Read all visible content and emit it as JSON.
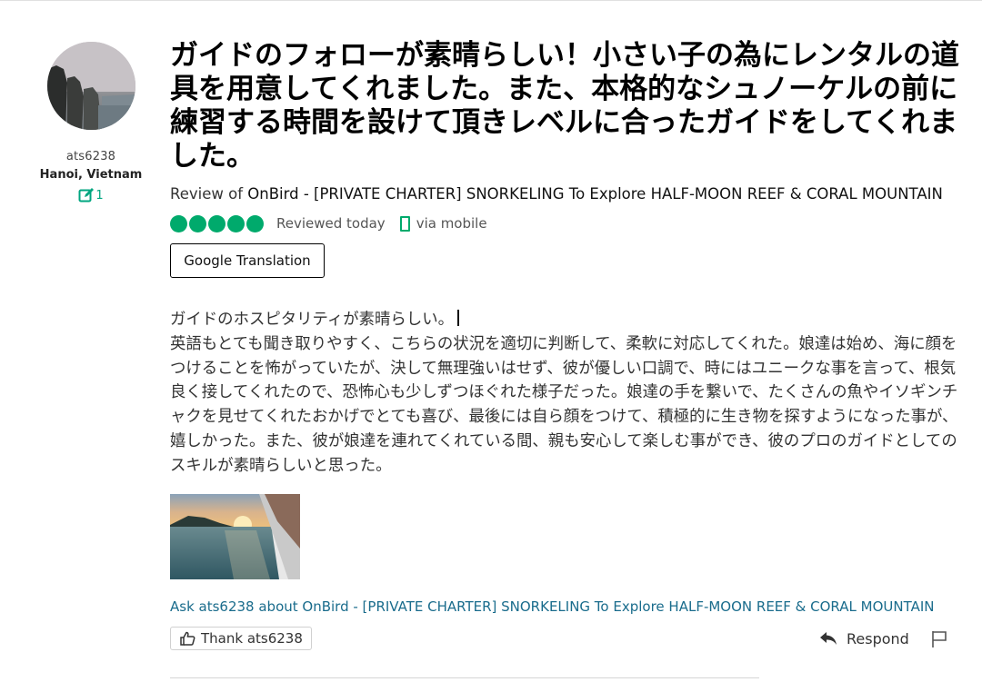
{
  "user": {
    "username": "ats6238",
    "location": "Hanoi, Vietnam",
    "contributions": "1",
    "avatar_icon": "user-avatar-cliffs-photo",
    "contrib_icon": "edit-square-icon"
  },
  "review": {
    "title": "ガイドのフォローが素晴らしい！小さい子の為にレンタルの道具を用意してくれました。また、本格的なシュノーケルの前に練習する時間を設けて頂きレベルに合ったガイドをしてくれました。",
    "review_of_prefix": "Review of ",
    "attraction": "OnBird - [PRIVATE CHARTER] SNORKELING To Explore HALF-MOON REEF & CORAL MOUNTAIN",
    "rating": 5,
    "rating_max": 5,
    "rating_color": "#00aa6c",
    "reviewed_date": "Reviewed today",
    "via": "via mobile",
    "translate_button": "Google Translation",
    "body_line1": "ガイドのホスピタリティが素晴らしい。",
    "body_rest": "英語もとても聞き取りやすく、こちらの状況を適切に判断して、柔軟に対応してくれた。娘達は始め、海に顔をつけることを怖がっていたが、決して無理強いはせず、彼が優しい口調で、時にはユニークな事を言って、根気良く接してくれたので、恐怖心も少しずつほぐれた様子だった。娘達の手を繋いで、たくさんの魚やイソギンチャクを見せてくれたおかげでとても喜び、最後には自ら顔をつけて、積極的に生き物を探すようになった事が、嬉しかった。また、彼が娘達を連れてくれている間、親も安心して楽しむ事ができ、彼のプロのガイドとしてのスキルが素晴らしいと思った。"
  },
  "actions": {
    "ask_link": "Ask ats6238 about OnBird - [PRIVATE CHARTER] SNORKELING To Explore HALF-MOON REEF & CORAL MOUNTAIN",
    "thank_label": "Thank ats6238",
    "respond_label": "Respond",
    "link_color": "#1a6c8c"
  }
}
